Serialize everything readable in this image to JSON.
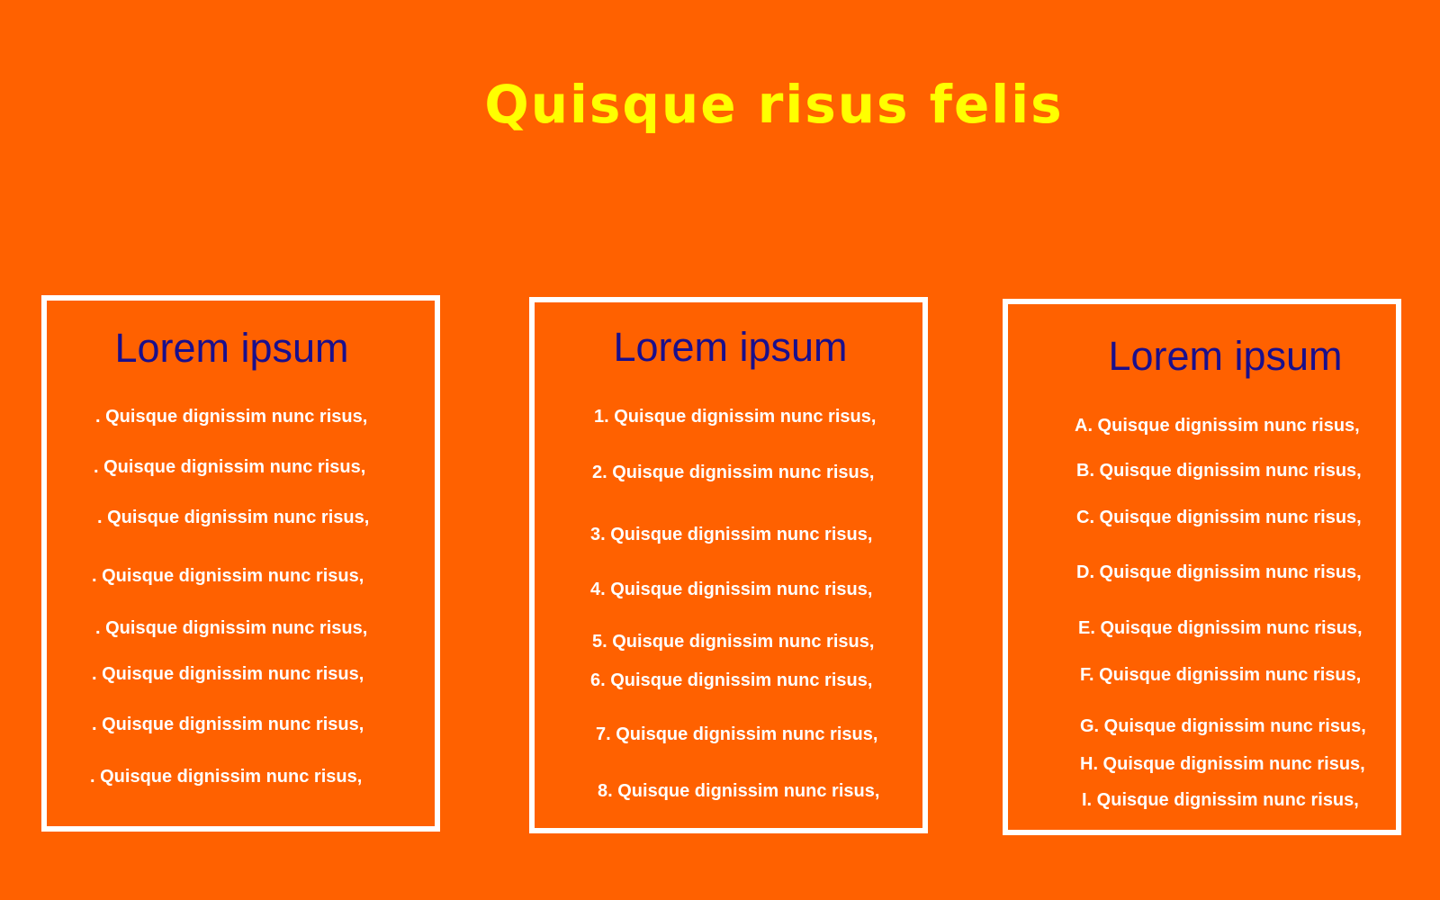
{
  "title": "Quisque risus felis",
  "colors": {
    "background": "#ff6100",
    "title": "#ffff00",
    "heading": "#1a0f8c",
    "text": "#ffffff",
    "border": "#ffffff"
  },
  "columns": [
    {
      "heading": "Lorem ipsum",
      "items": [
        ". Quisque dignissim nunc risus,",
        ". Quisque dignissim nunc risus,",
        ". Quisque dignissim nunc risus,",
        ". Quisque dignissim nunc risus,",
        ". Quisque dignissim nunc risus,",
        ". Quisque dignissim nunc risus,",
        ". Quisque dignissim nunc risus,",
        ". Quisque dignissim nunc risus,"
      ]
    },
    {
      "heading": "Lorem ipsum",
      "items": [
        "1. Quisque dignissim nunc risus,",
        "2. Quisque dignissim nunc risus,",
        "3. Quisque dignissim nunc risus,",
        "4. Quisque dignissim nunc risus,",
        "5. Quisque dignissim nunc risus,",
        "6. Quisque dignissim nunc risus,",
        "7. Quisque dignissim nunc risus,",
        "8. Quisque dignissim nunc risus,"
      ]
    },
    {
      "heading": "Lorem ipsum",
      "items": [
        "A. Quisque dignissim nunc risus,",
        "B. Quisque dignissim nunc risus,",
        "C. Quisque dignissim nunc risus,",
        "D. Quisque dignissim nunc risus,",
        "E. Quisque dignissim nunc risus,",
        "F. Quisque dignissim nunc risus,",
        "G. Quisque dignissim nunc risus,",
        "H. Quisque dignissim nunc risus,",
        "I. Quisque dignissim nunc risus,"
      ]
    }
  ]
}
